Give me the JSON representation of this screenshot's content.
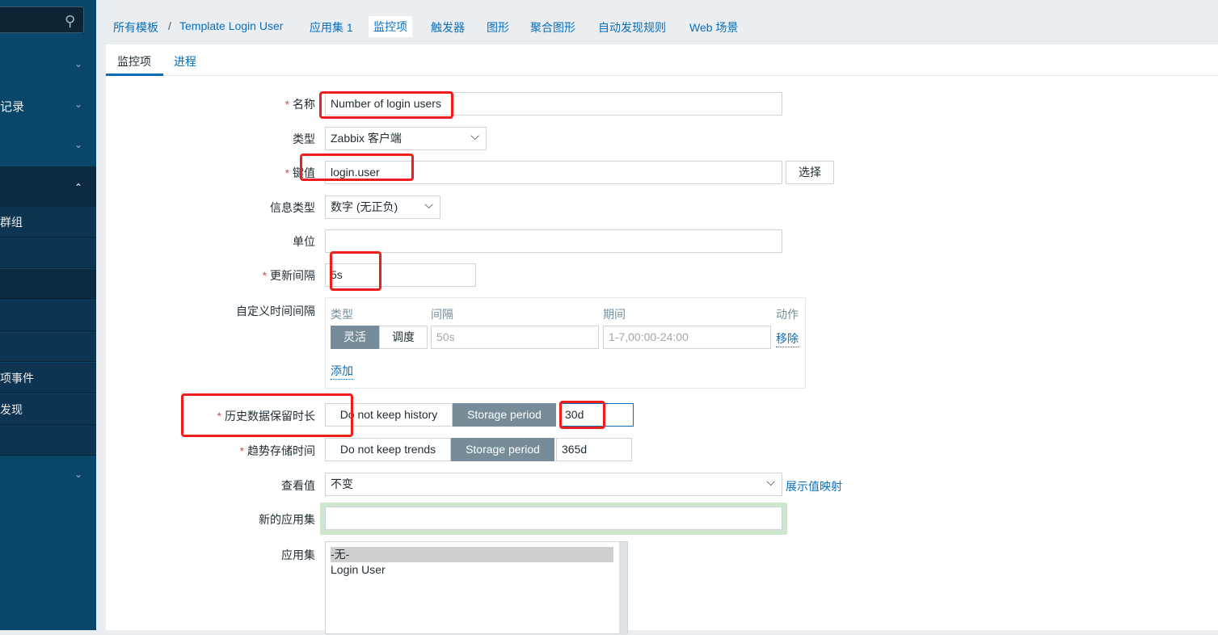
{
  "sidebar": {
    "items": [
      {
        "label": ""
      },
      {
        "label": "记录"
      },
      {
        "label": ""
      },
      {
        "label": ""
      }
    ],
    "subitems": [
      {
        "label": "群组"
      },
      {
        "label": ""
      },
      {
        "label": ""
      },
      {
        "label": ""
      },
      {
        "label": ""
      },
      {
        "label": "项事件"
      },
      {
        "label": "发现"
      },
      {
        "label": ""
      }
    ]
  },
  "breadcrumb": {
    "root": "所有模板",
    "sep": "/",
    "template": "Template Login User"
  },
  "nav": {
    "apps": "应用集 1",
    "items": "监控项",
    "triggers": "触发器",
    "graphs": "图形",
    "screens": "聚合图形",
    "discovery": "自动发现规则",
    "web": "Web 场景"
  },
  "tabs": {
    "items": "监控项",
    "process": "进程"
  },
  "form": {
    "name": {
      "label": "名称",
      "value": "Number of login users"
    },
    "type": {
      "label": "类型",
      "value": "Zabbix 客户端"
    },
    "key": {
      "label": "键值",
      "value": "login.user",
      "button": "选择"
    },
    "info_type": {
      "label": "信息类型",
      "value": "数字 (无正负)"
    },
    "units": {
      "label": "单位",
      "value": ""
    },
    "interval": {
      "label": "更新间隔",
      "value": "5s"
    },
    "custom": {
      "label": "自定义时间间隔",
      "col_type": "类型",
      "col_interval": "间隔",
      "col_period": "期间",
      "col_action": "动作",
      "flexible": "灵活",
      "scheduling": "调度",
      "interval_ph": "50s",
      "period_ph": "1-7,00:00-24:00",
      "remove": "移除",
      "add": "添加"
    },
    "history": {
      "label": "历史数据保留时长",
      "no_keep": "Do not keep history",
      "storage": "Storage period",
      "value": "30d"
    },
    "trends": {
      "label": "趋势存储时间",
      "no_keep": "Do not keep trends",
      "storage": "Storage period",
      "value": "365d"
    },
    "valuemap": {
      "label": "查看值",
      "value": "不变",
      "link": "展示值映射"
    },
    "new_app": {
      "label": "新的应用集",
      "value": ""
    },
    "apps": {
      "label": "应用集",
      "options": [
        "-无-",
        "Login User"
      ]
    }
  },
  "colors": {
    "sidebar": "#0a466a",
    "accent": "#0a6ebd",
    "highlight": "#f01d1d"
  }
}
